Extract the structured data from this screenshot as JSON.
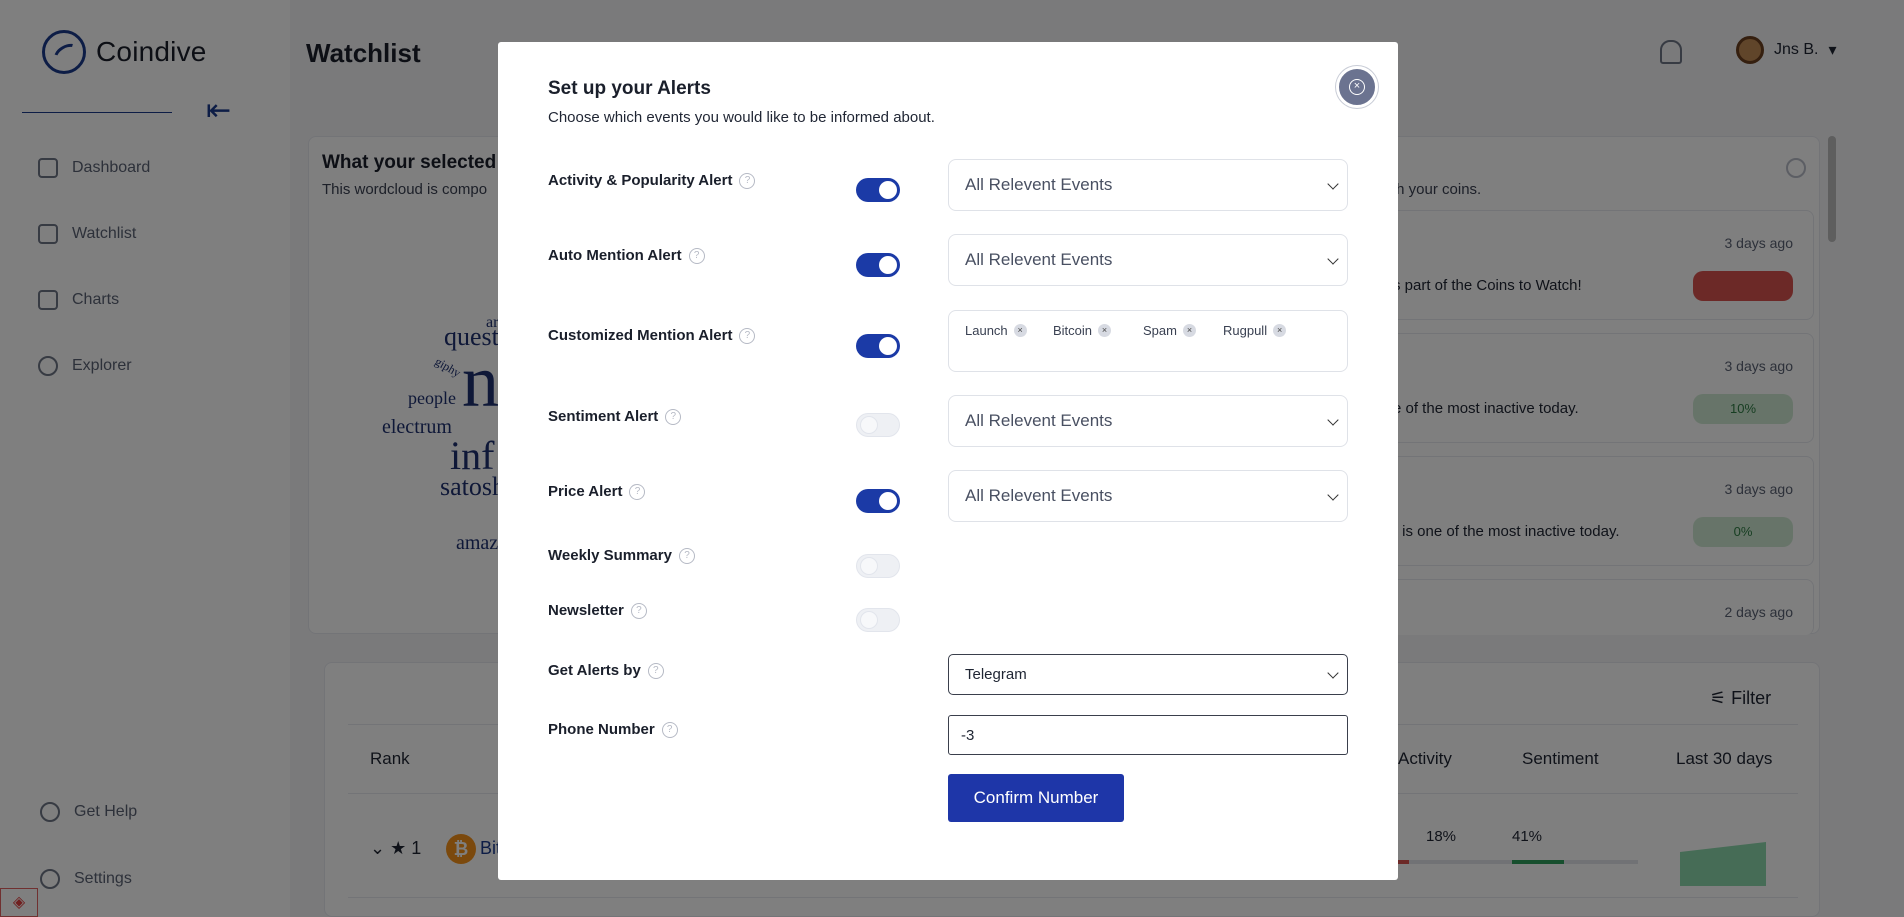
{
  "app": {
    "name": "Coindive",
    "page_title": "Watchlist"
  },
  "user": {
    "name": "Jns B."
  },
  "sidebar": {
    "items": [
      {
        "label": "Dashboard"
      },
      {
        "label": "Watchlist"
      },
      {
        "label": "Charts"
      },
      {
        "label": "Explorer"
      }
    ],
    "footer": [
      {
        "label": "Get Help"
      },
      {
        "label": "Settings"
      }
    ]
  },
  "card": {
    "title": "What your selected",
    "subtitle": "This wordcloud is compo",
    "subtitle_right": "th your coins.",
    "wordcloud": [
      "questi",
      "giphy",
      "people",
      "electrum",
      "inf",
      "satosh",
      "amaz",
      "ar",
      "n"
    ]
  },
  "events": [
    {
      "time": "3 days ago",
      "text": "s part of the Coins to Watch!",
      "badge": "",
      "badge_color": "#d9534f"
    },
    {
      "time": "3 days ago",
      "text": "e of the most inactive today.",
      "badge": "10%",
      "badge_color": "#cfe9d3"
    },
    {
      "time": "3 days ago",
      "text": ") is one of the most inactive today.",
      "badge": "0%",
      "badge_color": "#cfe9d3"
    },
    {
      "time": "2 days ago",
      "text": "",
      "badge": "",
      "badge_color": ""
    }
  ],
  "table": {
    "filter_label": "Filter",
    "headers": {
      "rank": "Rank",
      "activity": "Activity",
      "sentiment": "Sentiment",
      "last30": "Last 30 days"
    },
    "rows": [
      {
        "rank": "1",
        "name": "Bit",
        "activity": "18%",
        "activity_value": 0.18,
        "sentiment": "41%",
        "sentiment_value": 0.41
      }
    ]
  },
  "modal": {
    "title": "Set up your Alerts",
    "description": "Choose which events you would like to be informed about.",
    "alerts": [
      {
        "label": "Activity & Popularity Alert",
        "enabled": true,
        "select": "All Relevent Events"
      },
      {
        "label": "Auto Mention Alert",
        "enabled": true,
        "select": "All Relevent Events"
      },
      {
        "label": "Customized Mention Alert",
        "enabled": true,
        "tags": [
          "Launch",
          "Bitcoin",
          "Spam",
          "Rugpull"
        ]
      },
      {
        "label": "Sentiment Alert",
        "enabled": false,
        "select": "All Relevent Events"
      },
      {
        "label": "Price Alert",
        "enabled": true,
        "select": "All Relevent Events"
      },
      {
        "label": "Weekly Summary",
        "enabled": false
      },
      {
        "label": "Newsletter",
        "enabled": false
      }
    ],
    "get_alerts_by": {
      "label": "Get Alerts by",
      "value": "Telegram"
    },
    "phone": {
      "label": "Phone Number",
      "value": "-3"
    },
    "confirm_label": "Confirm Number"
  },
  "colors": {
    "accent": "#1e36a8",
    "toggle_on": "#1b3aa6"
  }
}
